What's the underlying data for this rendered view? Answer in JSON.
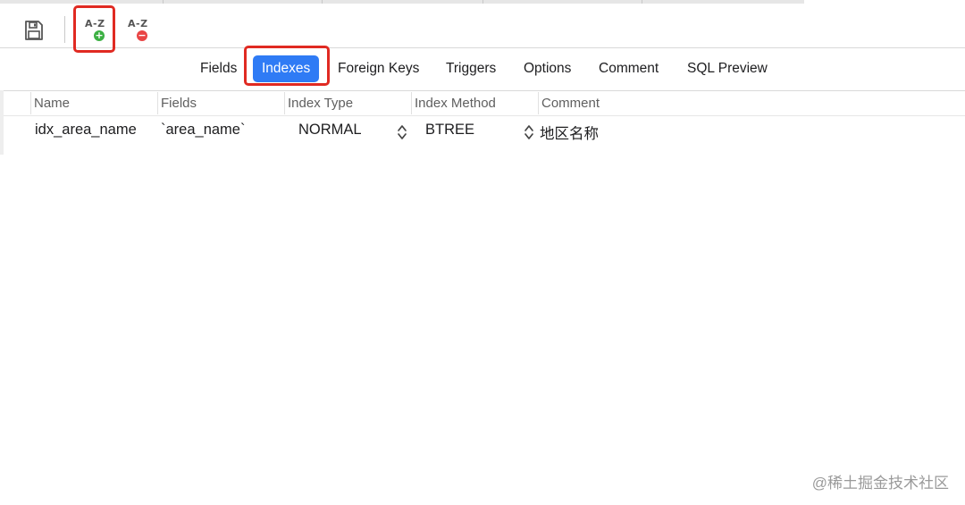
{
  "toolbar": {
    "save_icon": "floppy-disk-icon",
    "add_index_icon": "az-add-icon",
    "add_index_text": "A-Z",
    "add_badge": "+",
    "remove_index_icon": "az-remove-icon",
    "remove_index_text": "A-Z",
    "remove_badge": "−",
    "highlight_color": "#e02a22"
  },
  "tabs": [
    {
      "label": "Fields",
      "active": false
    },
    {
      "label": "Indexes",
      "active": true
    },
    {
      "label": "Foreign Keys",
      "active": false
    },
    {
      "label": "Triggers",
      "active": false
    },
    {
      "label": "Options",
      "active": false
    },
    {
      "label": "Comment",
      "active": false
    },
    {
      "label": "SQL Preview",
      "active": false
    }
  ],
  "accent_color": "#2f7bf5",
  "table": {
    "columns": [
      "Name",
      "Fields",
      "Index Type",
      "Index Method",
      "Comment"
    ],
    "rows": [
      {
        "name": "idx_area_name",
        "fields": "`area_name`",
        "index_type": "NORMAL",
        "index_method": "BTREE",
        "comment": "地区名称"
      }
    ]
  },
  "watermark": "@稀土掘金技术社区"
}
